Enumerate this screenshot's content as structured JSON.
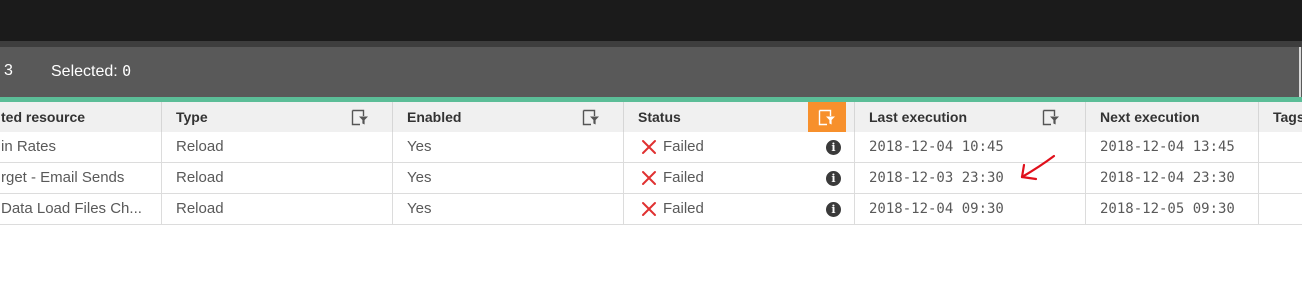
{
  "summary": {
    "count": "3",
    "selected_label": "Selected:",
    "selected_value": "0"
  },
  "columns": [
    {
      "key": "resource",
      "label": "ted resource",
      "filter": false
    },
    {
      "key": "type",
      "label": "Type",
      "filter": true,
      "active": false
    },
    {
      "key": "enabled",
      "label": "Enabled",
      "filter": true,
      "active": false
    },
    {
      "key": "status",
      "label": "Status",
      "filter": true,
      "active": true
    },
    {
      "key": "last",
      "label": "Last execution",
      "filter": true,
      "active": false
    },
    {
      "key": "next",
      "label": "Next execution",
      "filter": false
    },
    {
      "key": "tags",
      "label": "Tags",
      "filter": false
    }
  ],
  "rows": [
    {
      "resource": "in Rates",
      "type": "Reload",
      "enabled": "Yes",
      "status": "Failed",
      "last": "2018-12-04 10:45",
      "next": "2018-12-04 13:45",
      "tags": ""
    },
    {
      "resource": "rget - Email Sends",
      "type": "Reload",
      "enabled": "Yes",
      "status": "Failed",
      "last": "2018-12-03 23:30",
      "next": "2018-12-04 23:30",
      "tags": ""
    },
    {
      "resource": "Data Load Files Ch...",
      "type": "Reload",
      "enabled": "Yes",
      "status": "Failed",
      "last": "2018-12-04 09:30",
      "next": "2018-12-05 09:30",
      "tags": ""
    }
  ],
  "icons": {
    "status_failed": "x-icon",
    "info": "info-icon",
    "filter": "filter-icon",
    "annotation": "red-arrow-annotation"
  },
  "colors": {
    "accent": "#5bbd97",
    "active_filter": "#f7902c",
    "failed": "#e03131",
    "annotation": "#e0101b"
  }
}
